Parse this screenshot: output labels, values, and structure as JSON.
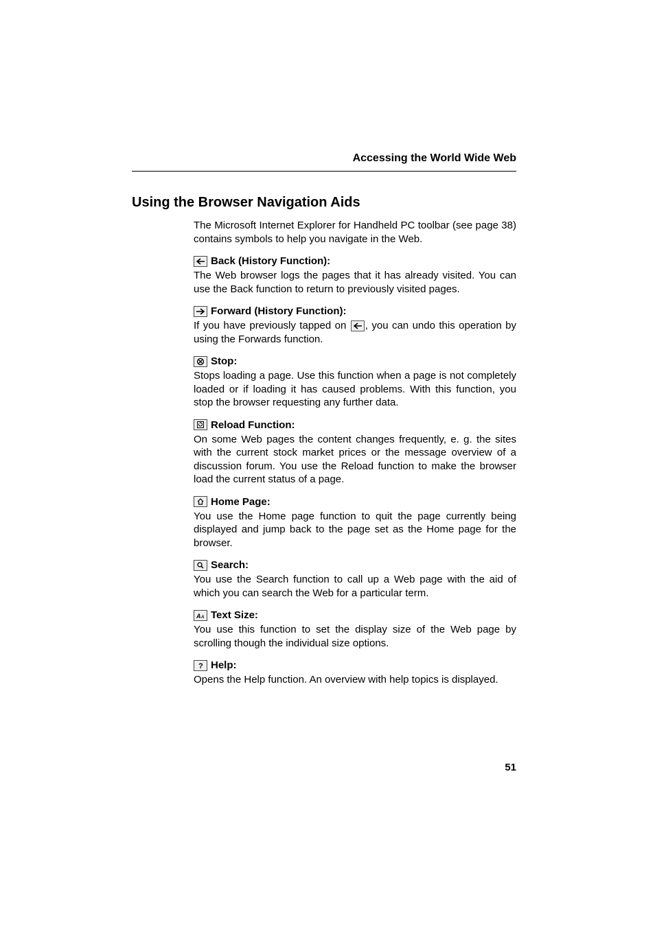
{
  "header": {
    "title": "Accessing the World Wide Web"
  },
  "section": {
    "title": "Using the Browser Navigation Aids",
    "intro": "The Microsoft Internet Explorer for Handheld PC toolbar (see page 38) contains symbols to help you navigate in the Web."
  },
  "items": {
    "back": {
      "title": "Back (History Function):",
      "body": "The Web browser logs the pages that it has already visited. You can use the Back function to return to previously visited pages."
    },
    "forward": {
      "title": "Forward (History Function):",
      "body_prefix": "If you have previously tapped on ",
      "body_suffix": ", you can undo this operation by using the Forwards function."
    },
    "stop": {
      "title": "Stop:",
      "body": "Stops loading a page. Use this function when a page is not completely loaded or if loading it has caused problems. With this function, you stop the browser requesting any further data."
    },
    "reload": {
      "title": "Reload Function:",
      "body": "On some Web pages the content changes frequently, e. g. the sites with the current stock market prices or the message overview of a discussion forum. You use the Reload function to make the browser load the current status of a page."
    },
    "home": {
      "title": "Home Page:",
      "body": "You use the Home page function to quit the page currently being displayed and jump back to the page set as the Home page for the browser."
    },
    "search": {
      "title": "Search:",
      "body": "You use the Search function to call up a Web page with the aid of which you can search the Web for a particular term."
    },
    "textsize": {
      "title": "Text Size:",
      "body": "You use this function to set the display size of the Web page by scrolling though the individual size options."
    },
    "help": {
      "title": "Help:",
      "body": "Opens the Help function. An overview with help topics is displayed."
    }
  },
  "page_number": "51"
}
